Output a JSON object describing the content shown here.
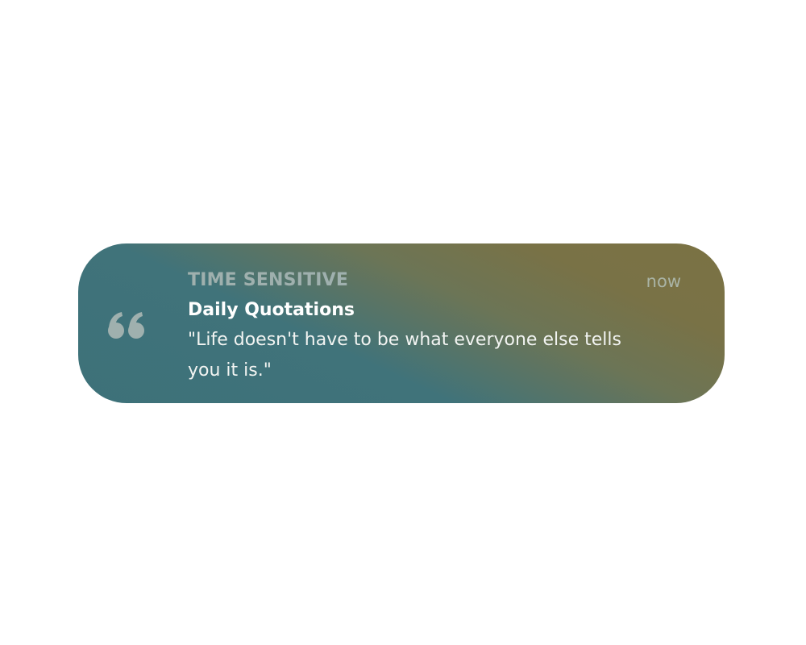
{
  "notification": {
    "icon": "quote-mark-icon",
    "category": "TIME SENSITIVE",
    "title": "Daily Quotations",
    "message": "\"Life doesn't have to be what everyone else tells you it is.\"",
    "time": "now"
  },
  "colors": {
    "page_background": "#ffffff",
    "gradient_start": "#3d7179",
    "gradient_end": "#7b7244",
    "category_text": "#9fb0ae",
    "icon": "#9fb0ae",
    "time_text": "#aab4a6",
    "title_text": "#ffffff"
  }
}
